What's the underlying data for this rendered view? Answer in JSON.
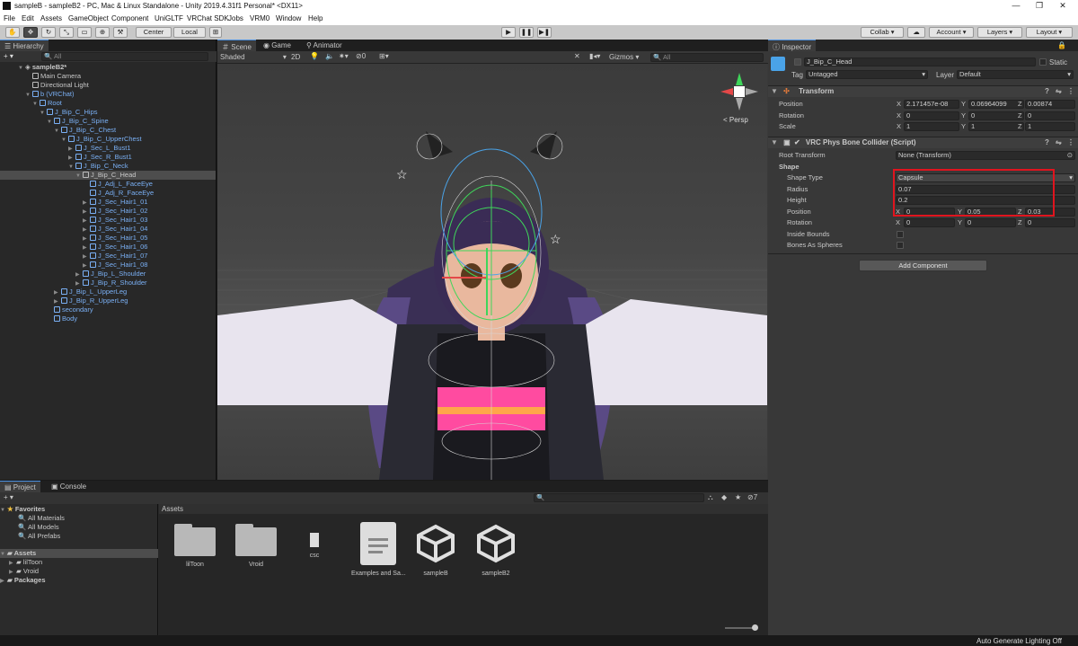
{
  "window": {
    "title": "sampleB - sampleB2 - PC, Mac & Linux Standalone - Unity 2019.4.31f1 Personal* <DX11>",
    "controls": [
      "—",
      "❐",
      "✕"
    ]
  },
  "menu": [
    "File",
    "Edit",
    "Assets",
    "GameObject",
    "Component",
    "UniGLTF",
    "VRChat SDK",
    "Jobs",
    "VRM0",
    "Window",
    "Help"
  ],
  "toolbar": {
    "pivot": "Center",
    "space": "Local",
    "collab": "Collab ▾",
    "account": "Account",
    "layers": "Layers",
    "layout": "Layout"
  },
  "hierarchy": {
    "tab": "Hierarchy",
    "search_placeholder": "All",
    "add": "+ ▾",
    "rows": [
      {
        "label": "sampleB2*",
        "indent": 0,
        "arrow": "▼",
        "icon": "scene",
        "color": "w",
        "bold": true
      },
      {
        "label": "Main Camera",
        "indent": 1,
        "arrow": "",
        "icon": "cube",
        "color": "w"
      },
      {
        "label": "Directional Light",
        "indent": 1,
        "arrow": "",
        "icon": "cube",
        "color": "w"
      },
      {
        "label": "b (VRChat)",
        "indent": 1,
        "arrow": "▼",
        "icon": "cube",
        "color": "b"
      },
      {
        "label": "Root",
        "indent": 2,
        "arrow": "▼",
        "icon": "cube",
        "color": "b"
      },
      {
        "label": "J_Bip_C_Hips",
        "indent": 3,
        "arrow": "▼",
        "icon": "cube",
        "color": "b"
      },
      {
        "label": "J_Bip_C_Spine",
        "indent": 4,
        "arrow": "▼",
        "icon": "cube",
        "color": "b"
      },
      {
        "label": "J_Bip_C_Chest",
        "indent": 5,
        "arrow": "▼",
        "icon": "cube",
        "color": "b"
      },
      {
        "label": "J_Bip_C_UpperChest",
        "indent": 6,
        "arrow": "▼",
        "icon": "cube",
        "color": "b"
      },
      {
        "label": "J_Sec_L_Bust1",
        "indent": 7,
        "arrow": "▶",
        "icon": "cube",
        "color": "b"
      },
      {
        "label": "J_Sec_R_Bust1",
        "indent": 7,
        "arrow": "▶",
        "icon": "cube",
        "color": "b"
      },
      {
        "label": "J_Bip_C_Neck",
        "indent": 7,
        "arrow": "▼",
        "icon": "cube",
        "color": "b"
      },
      {
        "label": "J_Bip_C_Head",
        "indent": 8,
        "arrow": "▼",
        "icon": "cube",
        "color": "w",
        "selected": true
      },
      {
        "label": "J_Adj_L_FaceEye",
        "indent": 9,
        "arrow": "",
        "icon": "cube",
        "color": "b"
      },
      {
        "label": "J_Adj_R_FaceEye",
        "indent": 9,
        "arrow": "",
        "icon": "cube",
        "color": "b"
      },
      {
        "label": "J_Sec_Hair1_01",
        "indent": 9,
        "arrow": "▶",
        "icon": "cube",
        "color": "b"
      },
      {
        "label": "J_Sec_Hair1_02",
        "indent": 9,
        "arrow": "▶",
        "icon": "cube",
        "color": "b"
      },
      {
        "label": "J_Sec_Hair1_03",
        "indent": 9,
        "arrow": "▶",
        "icon": "cube",
        "color": "b"
      },
      {
        "label": "J_Sec_Hair1_04",
        "indent": 9,
        "arrow": "▶",
        "icon": "cube",
        "color": "b"
      },
      {
        "label": "J_Sec_Hair1_05",
        "indent": 9,
        "arrow": "▶",
        "icon": "cube",
        "color": "b"
      },
      {
        "label": "J_Sec_Hair1_06",
        "indent": 9,
        "arrow": "▶",
        "icon": "cube",
        "color": "b"
      },
      {
        "label": "J_Sec_Hair1_07",
        "indent": 9,
        "arrow": "▶",
        "icon": "cube",
        "color": "b"
      },
      {
        "label": "J_Sec_Hair1_08",
        "indent": 9,
        "arrow": "▶",
        "icon": "cube",
        "color": "b"
      },
      {
        "label": "J_Bip_L_Shoulder",
        "indent": 8,
        "arrow": "▶",
        "icon": "cube",
        "color": "b"
      },
      {
        "label": "J_Bip_R_Shoulder",
        "indent": 8,
        "arrow": "▶",
        "icon": "cube",
        "color": "b"
      },
      {
        "label": "J_Bip_L_UpperLeg",
        "indent": 5,
        "arrow": "▶",
        "icon": "cube",
        "color": "b"
      },
      {
        "label": "J_Bip_R_UpperLeg",
        "indent": 5,
        "arrow": "▶",
        "icon": "cube",
        "color": "b"
      },
      {
        "label": "secondary",
        "indent": 4,
        "arrow": "",
        "icon": "cube",
        "color": "b"
      },
      {
        "label": "Body",
        "indent": 4,
        "arrow": "",
        "icon": "cube",
        "color": "b"
      }
    ]
  },
  "scene": {
    "tabs": [
      "Scene",
      "Game",
      "Animator"
    ],
    "shading": "Shaded",
    "mode2d": "2D",
    "gizmos": "Gizmos",
    "search_placeholder": "All",
    "layer_count": "0",
    "persp": "< Persp"
  },
  "inspector": {
    "tab": "Inspector",
    "object_name": "J_Bip_C_Head",
    "static": "Static",
    "tag_label": "Tag",
    "tag_value": "Untagged",
    "layer_label": "Layer",
    "layer_value": "Default",
    "transform": {
      "title": "Transform",
      "rows": [
        {
          "label": "Position",
          "x": "2.171457e-08",
          "y": "0.06964099",
          "z": "0.00874"
        },
        {
          "label": "Rotation",
          "x": "0",
          "y": "0",
          "z": "0"
        },
        {
          "label": "Scale",
          "x": "1",
          "y": "1",
          "z": "1"
        }
      ]
    },
    "collider": {
      "title": "VRC Phys Bone Collider (Script)",
      "root_transform_label": "Root Transform",
      "root_transform_value": "None (Transform)",
      "shape_label": "Shape",
      "shape_type_label": "Shape Type",
      "shape_type_value": "Capsule",
      "radius_label": "Radius",
      "radius_value": "0.07",
      "height_label": "Height",
      "height_value": "0.2",
      "position_label": "Position",
      "position": {
        "x": "0",
        "y": "0.05",
        "z": "0.03"
      },
      "rotation_label": "Rotation",
      "rotation": {
        "x": "0",
        "y": "0",
        "z": "0"
      },
      "inside_bounds_label": "Inside Bounds",
      "bones_as_spheres_label": "Bones As Spheres"
    },
    "add_component": "Add Component"
  },
  "project": {
    "tabs": [
      "Project",
      "Console"
    ],
    "add": "+ ▾",
    "favorites": "Favorites",
    "fav_items": [
      "All Materials",
      "All Models",
      "All Prefabs"
    ],
    "assets_root": "Assets",
    "asset_children": [
      "lilToon",
      "Vroid"
    ],
    "packages": "Packages",
    "breadcrumb": "Assets",
    "count": "7",
    "assets": [
      {
        "label": "lilToon",
        "kind": "folder"
      },
      {
        "label": "Vroid",
        "kind": "folder"
      },
      {
        "label": "csc",
        "kind": "file-small"
      },
      {
        "label": "Examples and Sa...",
        "kind": "doc"
      },
      {
        "label": "sampleB",
        "kind": "unity"
      },
      {
        "label": "sampleB2",
        "kind": "unity"
      }
    ]
  },
  "status": {
    "text": "Auto Generate Lighting Off"
  },
  "colors": {
    "accent": "#4a90e2",
    "selection_blue": "#7ab0f5",
    "highlight_red": "#e0141e"
  }
}
